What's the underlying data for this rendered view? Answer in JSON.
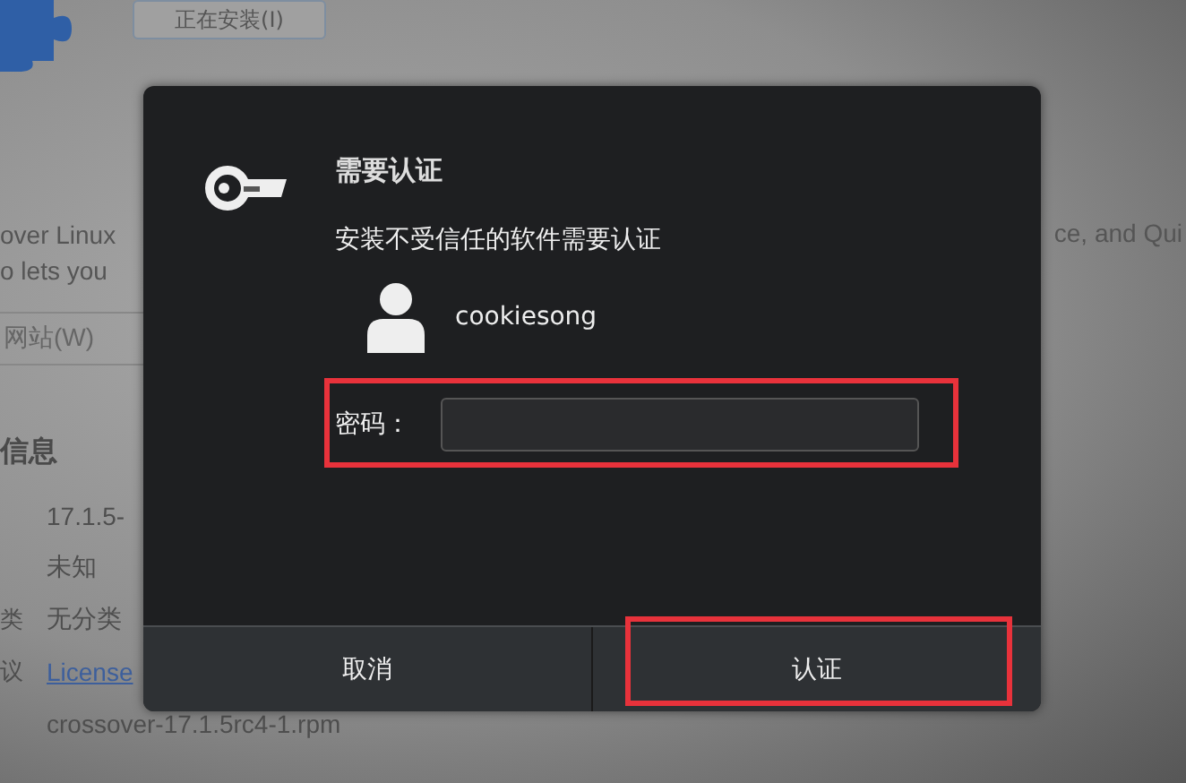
{
  "background": {
    "install_button": "正在安装(I)",
    "description_lines": [
      "over Linux",
      "o lets you"
    ],
    "description_tail": "ce, and Qui",
    "website_button": "网站(W)",
    "section_title": "信息",
    "details": [
      {
        "value": "17.1.5-",
        "kind": "text"
      },
      {
        "value": "未知",
        "kind": "text"
      },
      {
        "label": "类",
        "value": "无分类",
        "kind": "text"
      },
      {
        "label": "议",
        "value": "License",
        "kind": "link"
      },
      {
        "value": "crossover-17.1.5rc4-1.rpm",
        "kind": "text"
      }
    ]
  },
  "dialog": {
    "title": "需要认证",
    "message": "安装不受信任的软件需要认证",
    "username": "cookiesong",
    "password": {
      "label": "密码：",
      "highlighted": true
    },
    "buttons": [
      {
        "label": "取消",
        "highlighted": false
      },
      {
        "label": "认证",
        "highlighted": true
      }
    ]
  }
}
